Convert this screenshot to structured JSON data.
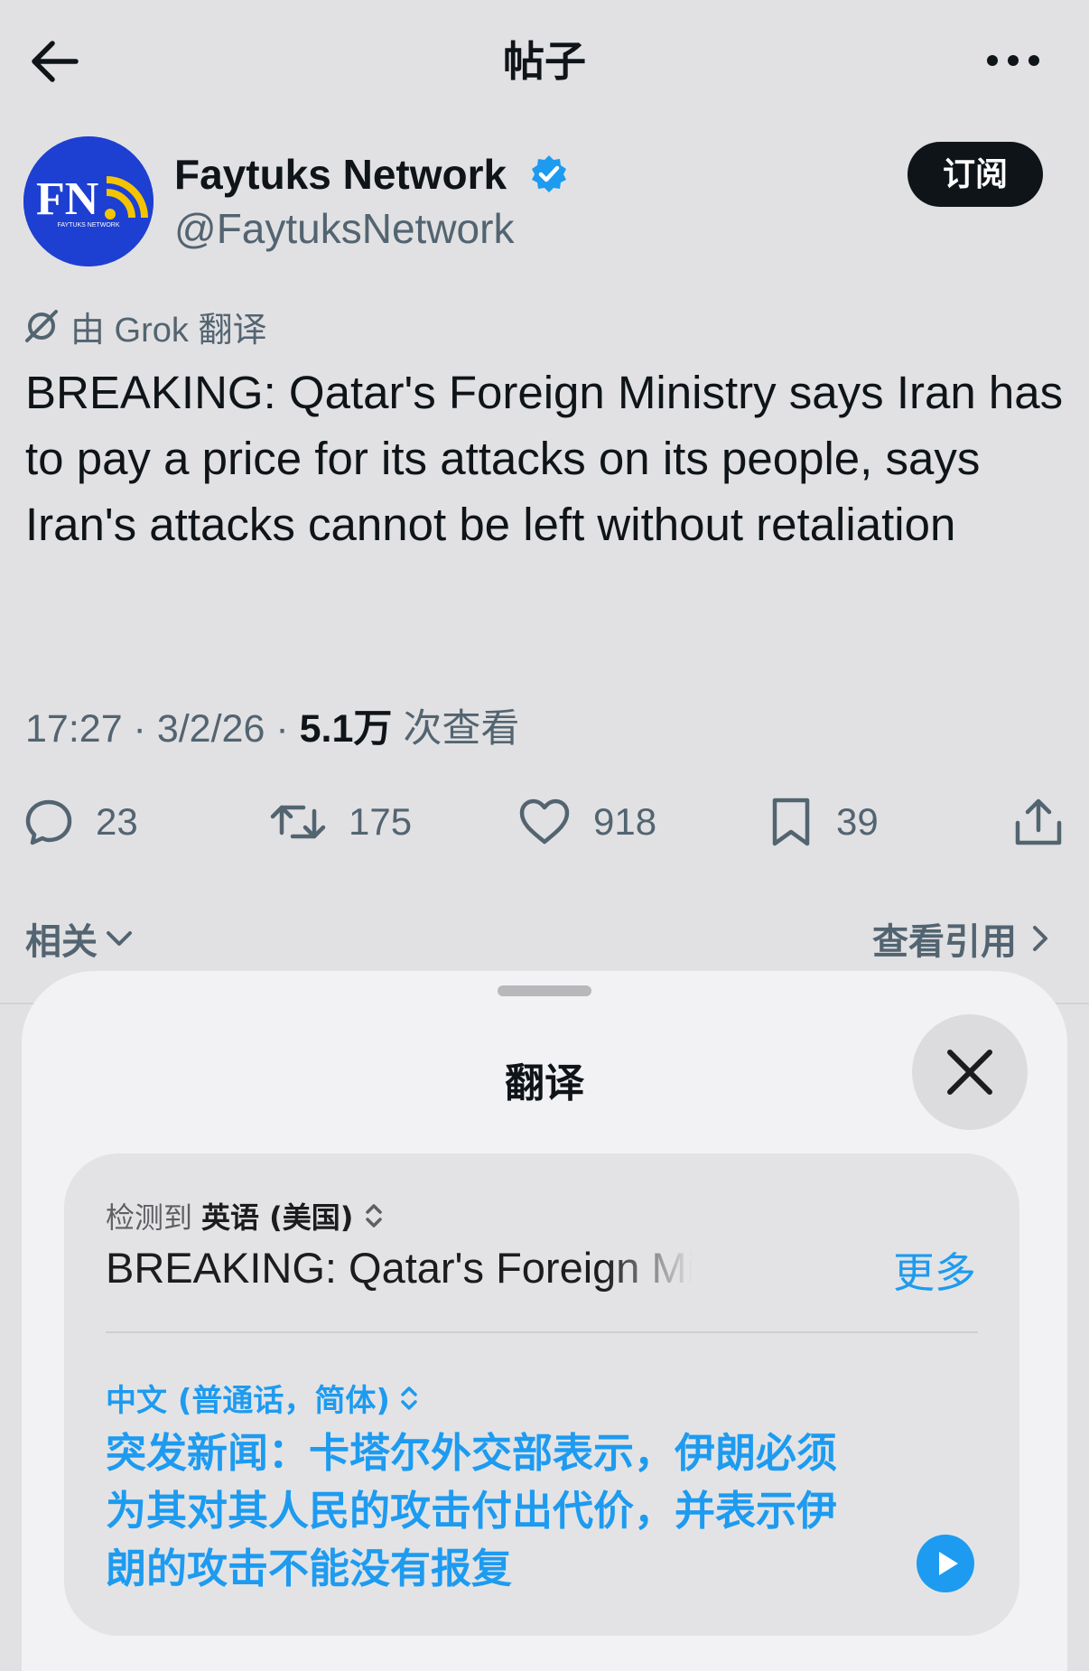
{
  "header": {
    "title": "帖子"
  },
  "author": {
    "display_name": "Faytuks Network",
    "handle": "@FaytuksNetwork",
    "avatar_letters": "FN",
    "avatar_subtext": "FAYTUKS NETWORK",
    "subscribe_label": "订阅"
  },
  "translation_note": "由 Grok 翻译",
  "tweet": {
    "text": "BREAKING: Qatar's Foreign Ministry says Iran has to pay a price for its attacks on its people, says Iran's attacks cannot be left without retaliation",
    "time": "17:27 · 3/2/26 · ",
    "views_count": "5.1万",
    "views_label": " 次查看"
  },
  "actions": {
    "replies": "23",
    "retweets": "175",
    "likes": "918",
    "bookmarks": "39"
  },
  "related_label": "相关",
  "view_quotes_label": "查看引用",
  "sheet": {
    "title": "翻译",
    "detected_prefix": "检测到",
    "source_language": "英语 (美国)",
    "source_text": "BREAKING: Qatar's Foreign Ministry says Iran",
    "more_label": "更多",
    "target_language": "中文 (普通话，简体)",
    "target_text": "突发新闻：卡塔尔外交部表示，伊朗必须为其对其人民的攻击付出代价，并表示伊朗的攻击不能没有报复"
  },
  "colors": {
    "accent": "#1d9bf0",
    "background": "#e1e1e3",
    "sheet": "#f2f2f4",
    "avatar": "#1d3fd2",
    "avatar_signal": "#f5c400"
  },
  "icons": {
    "back": "arrow-left-icon",
    "more": "ellipsis-icon",
    "verified": "verified-badge-icon",
    "grok": "grok-icon",
    "reply": "reply-icon",
    "retweet": "retweet-icon",
    "like": "heart-icon",
    "bookmark": "bookmark-icon",
    "share": "share-icon",
    "close": "close-icon",
    "play": "play-icon"
  }
}
